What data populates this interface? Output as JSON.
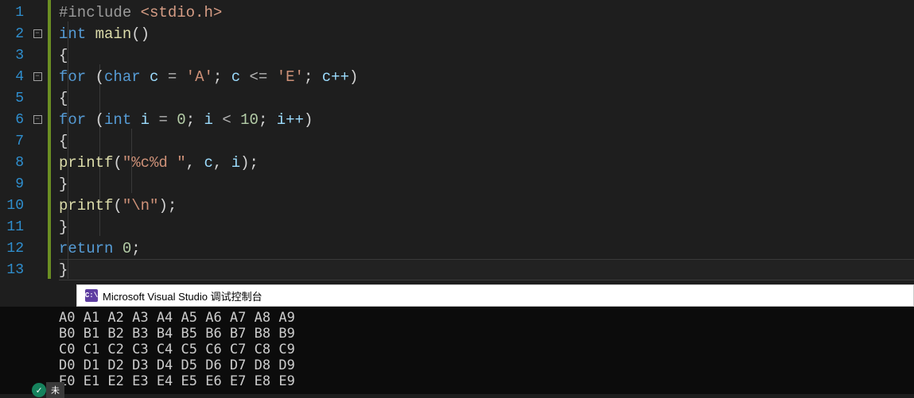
{
  "editor": {
    "lines": [
      "1",
      "2",
      "3",
      "4",
      "5",
      "6",
      "7",
      "8",
      "9",
      "10",
      "11",
      "12",
      "13"
    ],
    "fold_collapsed_glyph": "−",
    "code": {
      "l1_pp": "#include ",
      "l1_inc": "<stdio.h>",
      "l2_kw": "int",
      "l2_fn": " main",
      "l2_paren": "()",
      "l3_brace": "{",
      "l4_for": "for",
      "l4_open": " (",
      "l4_char": "char",
      "l4_c": " c ",
      "l4_eq": "= ",
      "l4_A": "'A'",
      "l4_semi1": "; ",
      "l4_c2": "c ",
      "l4_le": "<= ",
      "l4_E": "'E'",
      "l4_semi2": "; ",
      "l4_cpp": "c++",
      "l4_close": ")",
      "l5_brace": "{",
      "l6_for": "for",
      "l6_open": " (",
      "l6_int": "int",
      "l6_i": " i ",
      "l6_eq": "= ",
      "l6_0": "0",
      "l6_semi1": "; ",
      "l6_i2": "i ",
      "l6_lt": "< ",
      "l6_10": "10",
      "l6_semi2": "; ",
      "l6_ipp": "i++",
      "l6_close": ")",
      "l7_brace": "{",
      "l8_printf": "printf",
      "l8_open": "(",
      "l8_str": "\"%c%d \"",
      "l8_comma": ", ",
      "l8_c": "c",
      "l8_comma2": ", ",
      "l8_i": "i",
      "l8_close": ");",
      "l9_brace": "}",
      "l10_printf": "printf",
      "l10_open": "(",
      "l10_str": "\"\\n\"",
      "l10_close": ");",
      "l11_brace": "}",
      "l12_return": "return",
      "l12_sp": " ",
      "l12_0": "0",
      "l12_semi": ";",
      "l13_brace": "}"
    }
  },
  "console": {
    "icon_text": "C:\\",
    "title": "Microsoft Visual Studio 调试控制台",
    "output": "A0 A1 A2 A3 A4 A5 A6 A7 A8 A9\nB0 B1 B2 B3 B4 B5 B6 B7 B8 B9\nC0 C1 C2 C3 C4 C5 C6 C7 C8 C9\nD0 D1 D2 D3 D4 D5 D6 D7 D8 D9\nE0 E1 E2 E3 E4 E5 E6 E7 E8 E9"
  },
  "status": {
    "check": "✓",
    "text": "未"
  }
}
